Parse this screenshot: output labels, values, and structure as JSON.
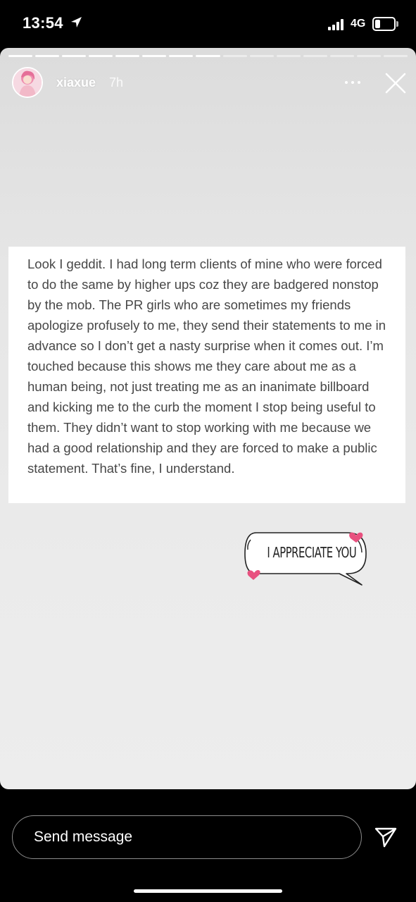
{
  "status_bar": {
    "time": "13:54",
    "network": "4G",
    "icons": [
      "location-arrow-icon",
      "signal-icon",
      "battery-icon"
    ]
  },
  "story": {
    "username": "xiaxue",
    "time_ago": "7h",
    "progress_segments_total": 15,
    "progress_segments_done": 8,
    "body_text": "Look I geddit. I had long term clients of mine who were forced to do the same by higher ups coz they are badgered nonstop by the mob. The PR girls who are sometimes my friends apologize profusely to me, they send their statements to me in advance so I don’t get a nasty surprise when it comes out. I’m touched because this shows me they care about me as a human being, not just treating me as an inanimate billboard and kicking me to the curb the moment I stop being useful to them. They didn’t want to stop working with me because we had a good relationship and they are forced to make a public statement. That’s fine, I understand.",
    "sticker_text": "I APPRECIATE YOU",
    "icons": [
      "more-options-icon",
      "close-icon"
    ]
  },
  "reply": {
    "placeholder": "Send message",
    "icons": [
      "send-icon"
    ]
  },
  "colors": {
    "background": "#000000",
    "story_bg": "#e9e9e9",
    "text_card": "#ffffff",
    "body_text": "#474747",
    "heart": "#e8517f"
  }
}
